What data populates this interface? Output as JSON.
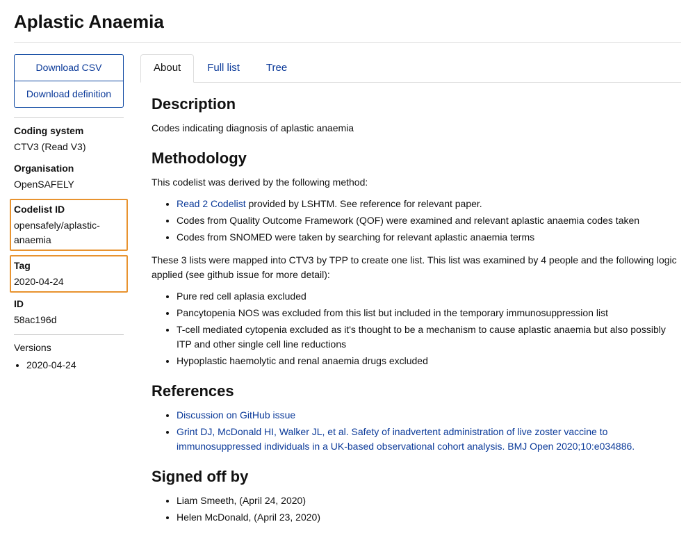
{
  "title": "Aplastic Anaemia",
  "sidebar": {
    "download_csv": "Download CSV",
    "download_def": "Download definition",
    "coding_system_label": "Coding system",
    "coding_system_value": "CTV3 (Read V3)",
    "organisation_label": "Organisation",
    "organisation_value": "OpenSAFELY",
    "codelist_id_label": "Codelist ID",
    "codelist_id_value": "opensafely/aplastic-anaemia",
    "tag_label": "Tag",
    "tag_value": "2020-04-24",
    "id_label": "ID",
    "id_value": "58ac196d",
    "versions_label": "Versions",
    "versions": [
      "2020-04-24"
    ]
  },
  "tabs": {
    "about": "About",
    "full_list": "Full list",
    "tree": "Tree"
  },
  "description": {
    "heading": "Description",
    "text": "Codes indicating diagnosis of aplastic anaemia"
  },
  "methodology": {
    "heading": "Methodology",
    "intro": "This codelist was derived by the following method:",
    "sources": {
      "read2_link": "Read 2 Codelist",
      "read2_rest": " provided by LSHTM. See reference for relevant paper.",
      "qof": "Codes from Quality Outcome Framework (QOF) were examined and relevant aplastic anaemia codes taken",
      "snomed": "Codes from SNOMED were taken by searching for relevant aplastic anaemia terms"
    },
    "mapping_note": "These 3 lists were mapped into CTV3 by TPP to create one list. This list was examined by 4 people and the following logic applied (see github issue for more detail):",
    "exclusions": [
      "Pure red cell aplasia excluded",
      "Pancytopenia NOS was excluded from this list but included in the temporary immunosuppression list",
      "T-cell mediated cytopenia excluded as it's thought to be a mechanism to cause aplastic anaemia but also possibly ITP and other single cell line reductions",
      "Hypoplastic haemolytic and renal anaemia drugs excluded"
    ]
  },
  "references": {
    "heading": "References",
    "items": [
      "Discussion on GitHub issue",
      "Grint DJ, McDonald HI, Walker JL, et al. Safety of inadvertent administration of live zoster vaccine to immunosuppressed individuals in a UK-based observational cohort analysis. BMJ Open 2020;10:e034886."
    ]
  },
  "signed_off": {
    "heading": "Signed off by",
    "items": [
      "Liam Smeeth, (April 24, 2020)",
      "Helen McDonald, (April 23, 2020)"
    ]
  }
}
